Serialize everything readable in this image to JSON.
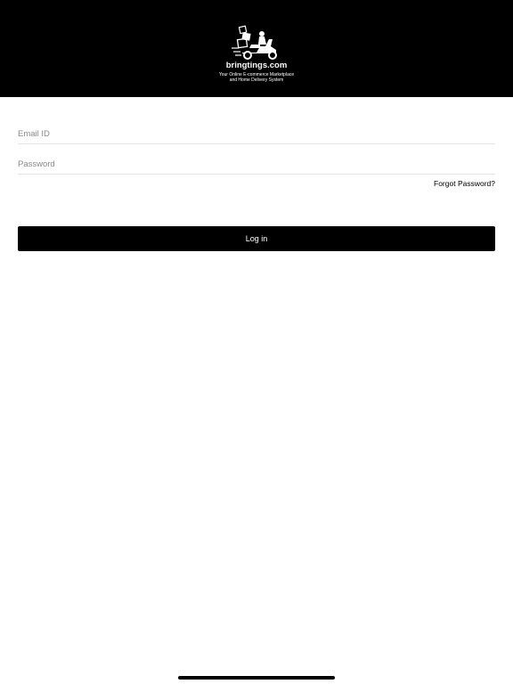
{
  "header": {
    "brand_name": "bringtings.com",
    "tagline_line1": "Your Online E-commerce Marketplace",
    "tagline_line2": "and Home Delivery System",
    "logo_icon": "delivery-scooter-icon",
    "background_color": "#000000"
  },
  "form": {
    "email_placeholder": "Email ID",
    "password_placeholder": "Password",
    "forgot_password_label": "Forgot Password?",
    "login_button_label": "Log in",
    "button_color": "#000000"
  }
}
